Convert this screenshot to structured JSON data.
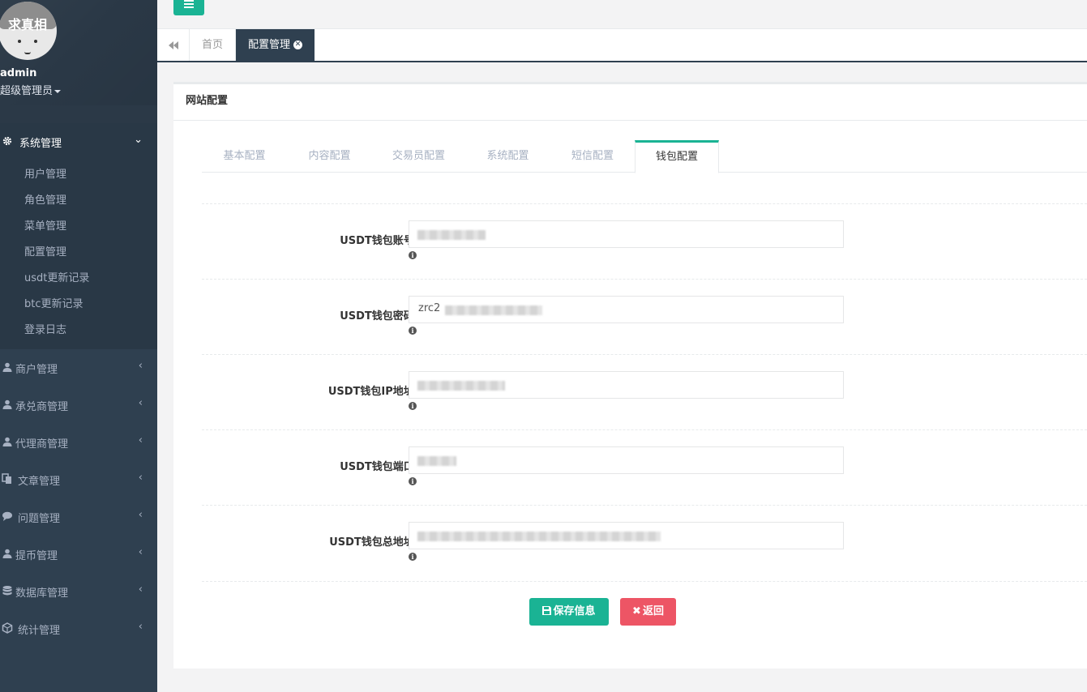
{
  "profile": {
    "avatar_text": "求真相",
    "name": "admin",
    "role": "超级管理员"
  },
  "sidebar": {
    "system": {
      "label": "系统管理",
      "icon": "gear-icon"
    },
    "sub_items": [
      "用户管理",
      "角色管理",
      "菜单管理",
      "配置管理",
      "usdt更新记录",
      "btc更新记录",
      "登录日志"
    ],
    "sections": [
      {
        "label": "商户管理",
        "icon": "user-icon"
      },
      {
        "label": "承兑商管理",
        "icon": "user-icon"
      },
      {
        "label": "代理商管理",
        "icon": "user-icon"
      },
      {
        "label": "文章管理",
        "icon": "copy-icon"
      },
      {
        "label": "问题管理",
        "icon": "comment-icon"
      },
      {
        "label": "提币管理",
        "icon": "user-icon"
      },
      {
        "label": "数据库管理",
        "icon": "database-icon"
      },
      {
        "label": "统计管理",
        "icon": "cube-icon"
      }
    ]
  },
  "top_tabs": {
    "home": "首页",
    "config": "配置管理"
  },
  "panel": {
    "title": "网站配置",
    "tabs": [
      "基本配置",
      "内容配置",
      "交易员配置",
      "系统配置",
      "短信配置",
      "钱包配置"
    ],
    "active_tab": "钱包配置",
    "fields": [
      {
        "label": "USDT钱包账号:",
        "value": ""
      },
      {
        "label": "USDT钱包密码:",
        "value": "zrc2"
      },
      {
        "label": "USDT钱包IP地址:",
        "value": ""
      },
      {
        "label": "USDT钱包端口:",
        "value": ""
      },
      {
        "label": "USDT钱包总地址:",
        "value": ""
      }
    ],
    "save_label": "保存信息",
    "back_label": "返回"
  },
  "colors": {
    "sidebar": "#2f4050",
    "accent": "#1ab394",
    "danger": "#ed5565"
  }
}
